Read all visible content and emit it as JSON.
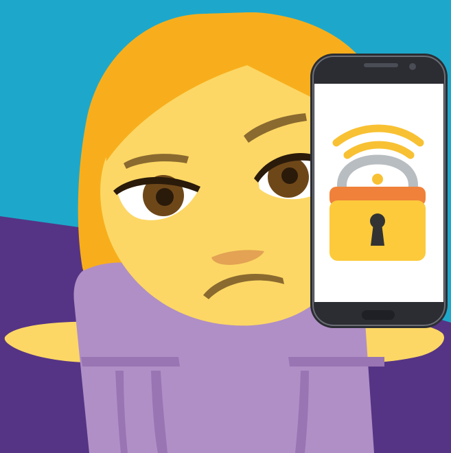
{
  "illustration": {
    "subject": "shrugging-woman-icon",
    "device": "smartphone-icon",
    "screen_graphic": "wifi-lock-icon"
  },
  "colors": {
    "sky": "#1DA8CB",
    "purple_background": "#553485",
    "hair": "#F8AE1C",
    "skin": "#FCD765",
    "eye_white": "#FFFFFF",
    "iris": "#6E4719",
    "brow": "#8A6A2F",
    "lip": "#E3A254",
    "top": "#B08FC6",
    "top_shadow": "#9A75B3",
    "phone_body": "#2B2D33",
    "phone_screen": "#FFFFFF",
    "wifi_arcs": "#F8C133",
    "lock_shackle": "#B8BDC2",
    "lock_top": "#F0813A",
    "lock_body": "#FCCA3B",
    "keyhole": "#333333"
  }
}
